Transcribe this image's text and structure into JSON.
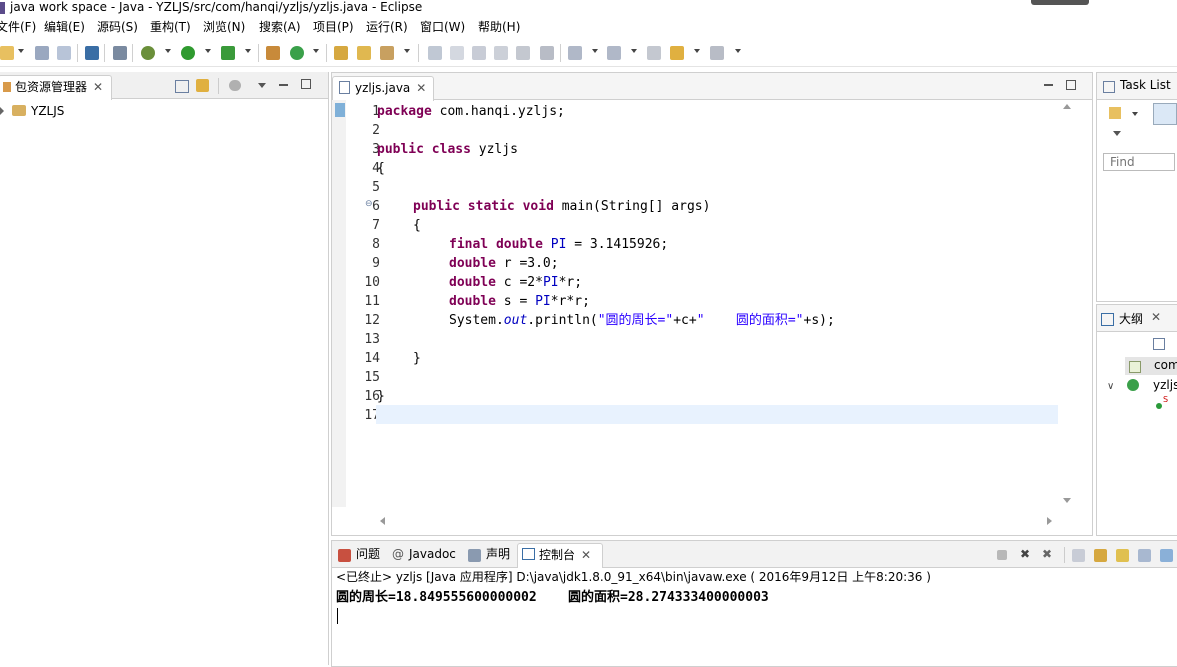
{
  "window": {
    "title": "java work space  -  Java  -  YZLJS/src/com/hanqi/yzljs/yzljs.java  -  Eclipse"
  },
  "menu": [
    "文件(F)",
    "编辑(E)",
    "源码(S)",
    "重构(T)",
    "浏览(N)",
    "搜索(A)",
    "项目(P)",
    "运行(R)",
    "窗口(W)",
    "帮助(H)"
  ],
  "explorer": {
    "tab_label": "包资源管理器",
    "project": "YZLJS"
  },
  "editor": {
    "tab_label": "yzljs.java",
    "line_numbers": [
      "1",
      "2",
      "3",
      "4",
      "5",
      "6",
      "7",
      "8",
      "9",
      "10",
      "11",
      "12",
      "13",
      "14",
      "15",
      "16",
      "17"
    ],
    "code": {
      "l1_kw": "package",
      "l1_rest": " com.hanqi.yzljs;",
      "l3_kw1": "public",
      "l3_kw2": "class",
      "l3_rest": " yzljs",
      "l4": "{",
      "l6_kw1": "public",
      "l6_kw2": "static",
      "l6_kw3": "void",
      "l6_rest": " main(String[] args)",
      "l7": "{",
      "l8_kw1": "final",
      "l8_kw2": "double",
      "l8_pi": "PI",
      "l8_rest": " = 3.1415926;",
      "l9_kw": "double",
      "l9_rest": " r =3.0;",
      "l10_kw": "double",
      "l10_a": " c =2*",
      "l10_pi": "PI",
      "l10_b": "*r;",
      "l11_kw": "double",
      "l11_a": " s = ",
      "l11_pi": "PI",
      "l11_b": "*r*r;",
      "l12_a": "System.",
      "l12_out": "out",
      "l12_b": ".println(",
      "l12_s1": "\"圆的周长=\"",
      "l12_c": "+c+",
      "l12_s2": "\"    圆的面积=\"",
      "l12_d": "+s);",
      "l14": "}",
      "l16": "}"
    }
  },
  "tasklist": {
    "tab_label": "Task List",
    "find_placeholder": "Find"
  },
  "outline": {
    "tab_label": "大纲",
    "item_package": "com",
    "item_class": "yzljs",
    "item_method": "S"
  },
  "console": {
    "tabs": [
      "问题",
      "Javadoc",
      "声明",
      "控制台"
    ],
    "status_line": "<已终止> yzljs [Java 应用程序] D:\\java\\jdk1.8.0_91_x64\\bin\\javaw.exe ( 2016年9月12日 上午8:20:36 )",
    "output_line": "圆的周长=18.849555600000002    圆的面积=28.274333400000003"
  }
}
